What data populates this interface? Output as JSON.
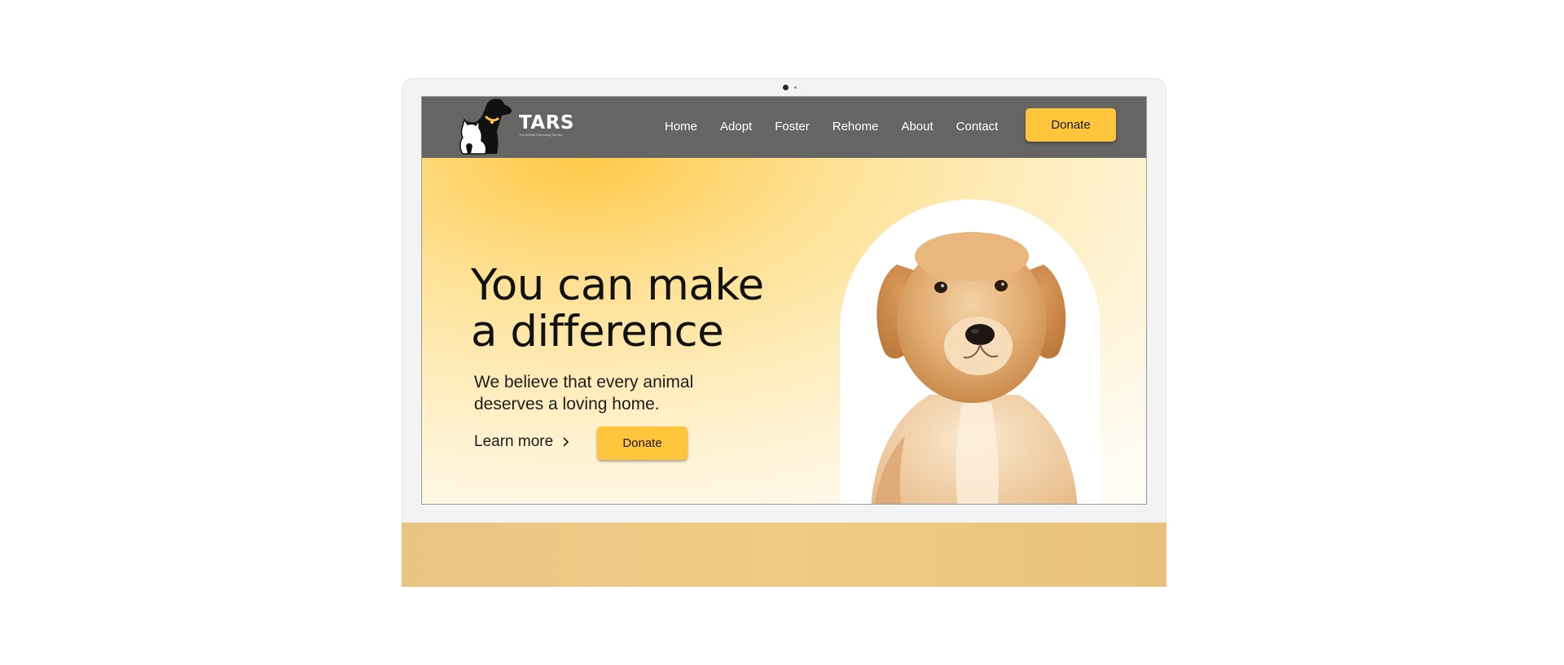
{
  "brand": {
    "name": "TARS",
    "tagline": "The Animal Rehoming Service",
    "logo_icon": "dog-and-cat-logo",
    "accent_color": "#fec43c",
    "collar_color": "#fec43c"
  },
  "nav": {
    "items": [
      {
        "label": "Home"
      },
      {
        "label": "Adopt"
      },
      {
        "label": "Foster"
      },
      {
        "label": "Rehome"
      },
      {
        "label": "About"
      },
      {
        "label": "Contact"
      }
    ],
    "donate_label": "Donate",
    "background_color": "#676563"
  },
  "hero": {
    "headline_line1": "You can make",
    "headline_line2": "a difference",
    "subtext": "We believe that every animal deserves a loving home.",
    "learn_more_label": "Learn more",
    "learn_more_icon": "chevron-right-icon",
    "donate_label": "Donate",
    "image_icon": "golden-retriever-puppy-image"
  }
}
